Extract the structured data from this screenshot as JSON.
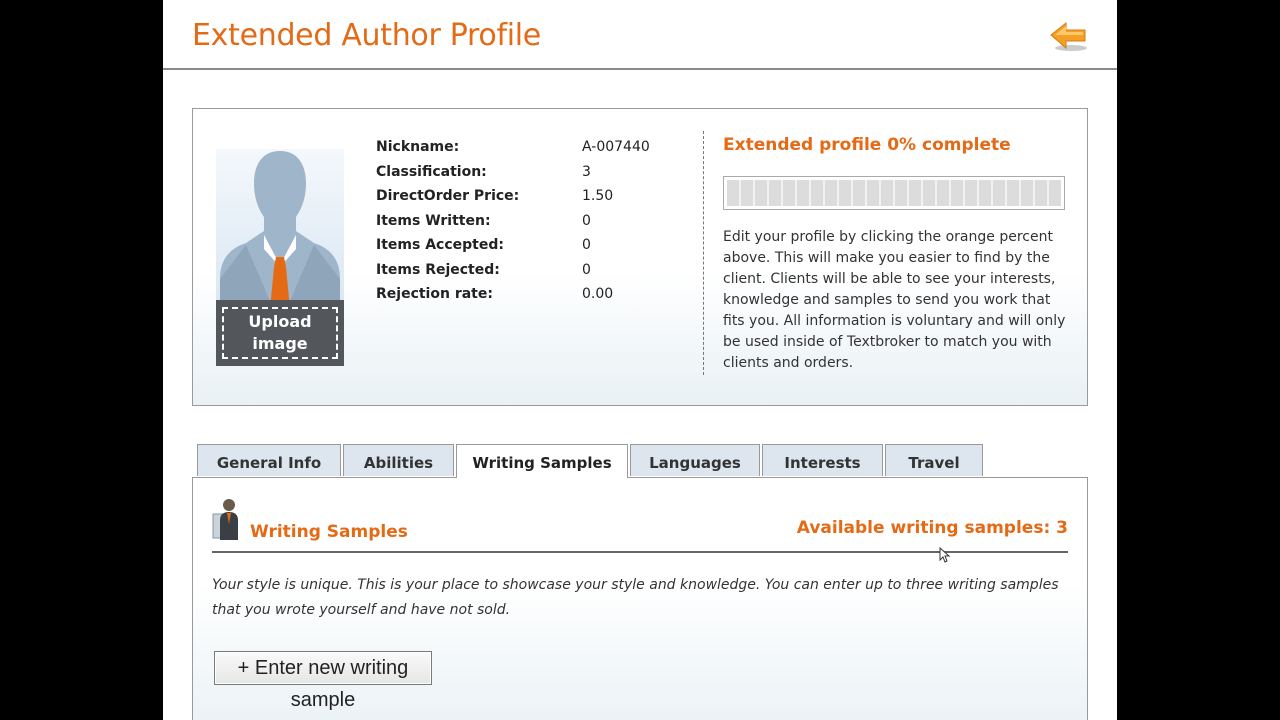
{
  "page": {
    "title": "Extended Author Profile",
    "back_icon": "left-arrow-icon"
  },
  "profile": {
    "avatar_icon": "person-silhouette-icon",
    "upload_label": "Upload image",
    "stats": [
      {
        "label": "Nickname:",
        "value": "A-007440"
      },
      {
        "label": "Classification:",
        "value": "3"
      },
      {
        "label": "DirectOrder Price:",
        "value": "1.50"
      },
      {
        "label": "Items Written:",
        "value": "0"
      },
      {
        "label": "Items Accepted:",
        "value": "0"
      },
      {
        "label": "Items Rejected:",
        "value": "0"
      },
      {
        "label": "Rejection rate:",
        "value": "0.00"
      }
    ],
    "complete_title": "Extended profile 0% complete",
    "progress_fraction": 0,
    "description": "Edit your profile by clicking the orange percent above. This will make you easier to find by the client. Clients will be able to see your interests, knowledge and samples to send you work that fits you. All information is voluntary and will only be used inside of Textbroker to match you with clients and orders."
  },
  "tabs": [
    {
      "label": "General Info",
      "active": false
    },
    {
      "label": "Abilities",
      "active": false
    },
    {
      "label": "Writing Samples",
      "active": true
    },
    {
      "label": "Languages",
      "active": false
    },
    {
      "label": "Interests",
      "active": false
    },
    {
      "label": "Travel",
      "active": false
    }
  ],
  "writing_samples": {
    "icon": "author-icon",
    "title": "Writing Samples",
    "available": "Available writing samples: 3",
    "description": "Your style is unique. This is your place to showcase your style and knowledge. You can enter up to three writing samples that you wrote yourself and have not sold.",
    "enter_button": "+ Enter new writing sample"
  },
  "colors": {
    "accent": "#e46a16",
    "tab_inactive": "#dde6ee",
    "border": "#999999"
  }
}
